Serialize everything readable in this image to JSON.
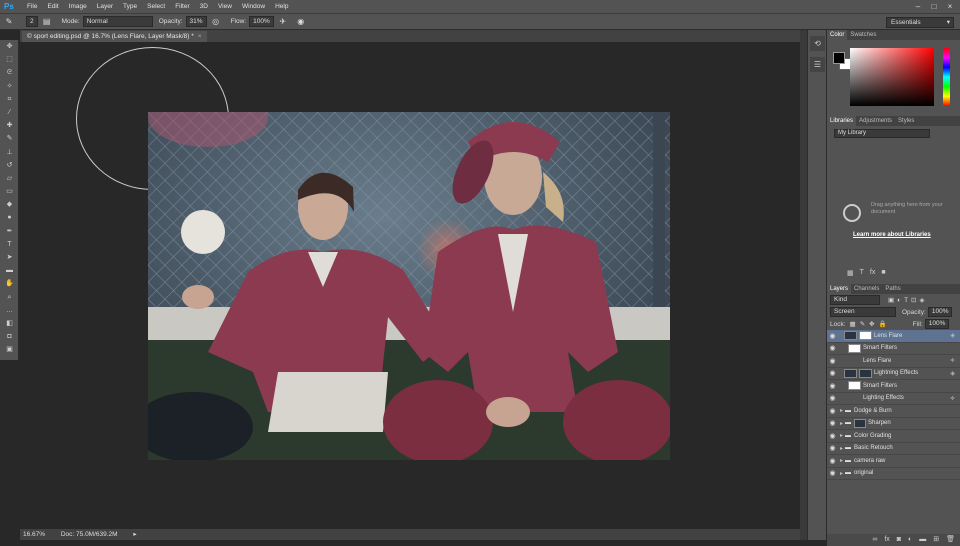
{
  "app": {
    "logo": "Ps"
  },
  "menu": [
    "File",
    "Edit",
    "Image",
    "Layer",
    "Type",
    "Select",
    "Filter",
    "3D",
    "View",
    "Window",
    "Help"
  ],
  "window_controls": [
    "minimize-icon",
    "maximize-icon",
    "close-icon"
  ],
  "options": {
    "brush_size": "2",
    "mode_label": "Mode:",
    "mode_value": "Normal",
    "opacity_label": "Opacity:",
    "opacity_value": "31%",
    "flow_label": "Flow:",
    "flow_value": "100%",
    "workspace": "Essentials"
  },
  "document": {
    "tab_title": "© sport editing.psd @ 16.7% (Lens Flare, Layer Mask/8) *",
    "zoom": "16.67%",
    "doc_info": "Doc: 75.0M/639.2M"
  },
  "color_panel": {
    "tabs": [
      "Color",
      "Swatches"
    ]
  },
  "libraries_panel": {
    "tabs": [
      "Libraries",
      "Adjustments",
      "Styles"
    ],
    "library": "My Library",
    "message": "Drag anything here from your document",
    "link": "Learn more about Libraries"
  },
  "layers_panel": {
    "tabs": [
      "Layers",
      "Channels",
      "Paths"
    ],
    "filter": "Kind",
    "blend_mode": "Screen",
    "opacity_label": "Opacity:",
    "opacity_value": "100%",
    "lock_label": "Lock:",
    "fill_label": "Fill:",
    "fill_value": "100%",
    "layers": [
      {
        "name": "Lens Flare",
        "selected": true
      },
      {
        "name": "Smart Filters"
      },
      {
        "name": "Lens Flare"
      },
      {
        "name": "Lightning Effects"
      },
      {
        "name": "Smart Filters"
      },
      {
        "name": "Lighting Effects"
      },
      {
        "name": "Dodge & Burn"
      },
      {
        "name": "Sharpen"
      },
      {
        "name": "Color Grading"
      },
      {
        "name": "Basic Retouch"
      },
      {
        "name": "camera raw"
      },
      {
        "name": "original"
      }
    ]
  },
  "colors": {
    "accent": "#5d7391",
    "ps_blue": "#31a8ff"
  }
}
